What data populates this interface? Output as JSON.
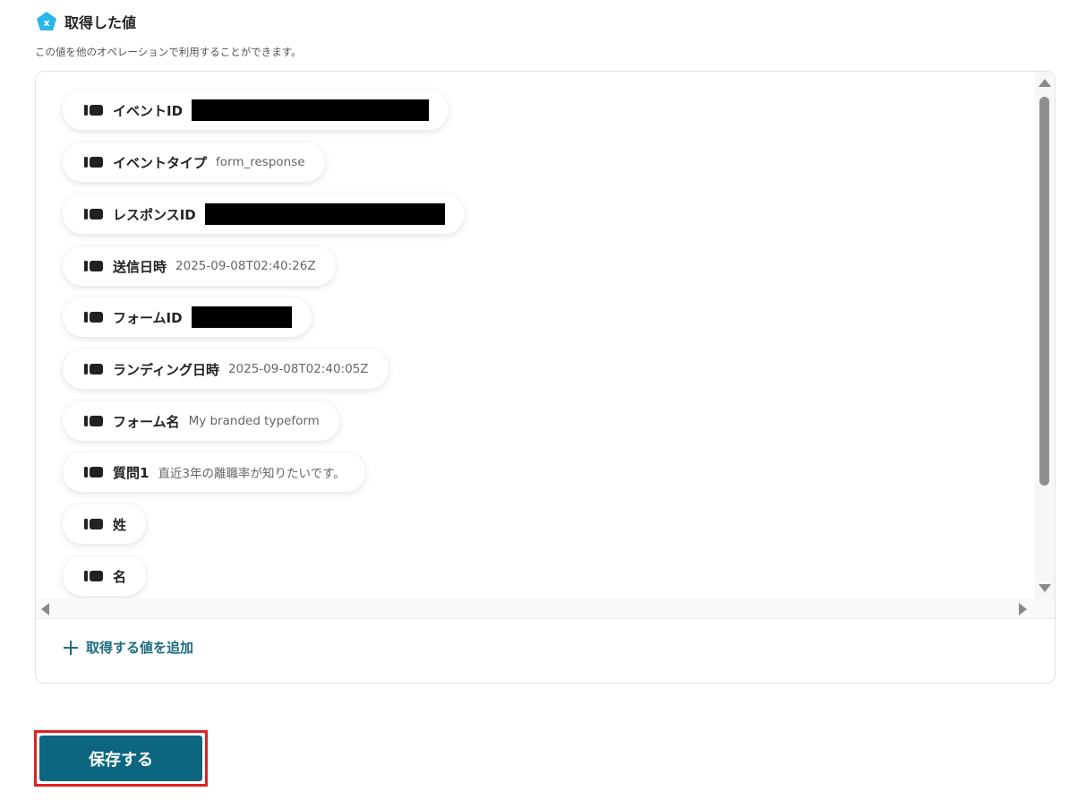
{
  "section": {
    "title": "取得した値",
    "description": "この値を他のオペレーションで利用することができます。",
    "icon": "pentagon-x-icon",
    "icon_color": "#29b6e8"
  },
  "items": [
    {
      "label": "イベントID",
      "value": "",
      "redacted": true
    },
    {
      "label": "イベントタイプ",
      "value": "form_response",
      "redacted": false
    },
    {
      "label": "レスポンスID",
      "value": "",
      "redacted": true
    },
    {
      "label": "送信日時",
      "value": "2025-09-08T02:40:26Z",
      "redacted": false
    },
    {
      "label": "フォームID",
      "value": "",
      "redacted": true
    },
    {
      "label": "ランディング日時",
      "value": "2025-09-08T02:40:05Z",
      "redacted": false
    },
    {
      "label": "フォーム名",
      "value": "My branded typeform",
      "redacted": false
    },
    {
      "label": "質問1",
      "value": "直近3年の離職率が知りたいです。",
      "redacted": false
    },
    {
      "label": "姓",
      "value": "",
      "redacted": false
    },
    {
      "label": "名",
      "value": "",
      "redacted": false
    }
  ],
  "add_value": {
    "label": "取得する値を追加"
  },
  "save_button": {
    "label": "保存する",
    "color": "#0d6680",
    "highlight_color": "#e02020"
  },
  "colors": {
    "accent": "#1b6c80"
  }
}
